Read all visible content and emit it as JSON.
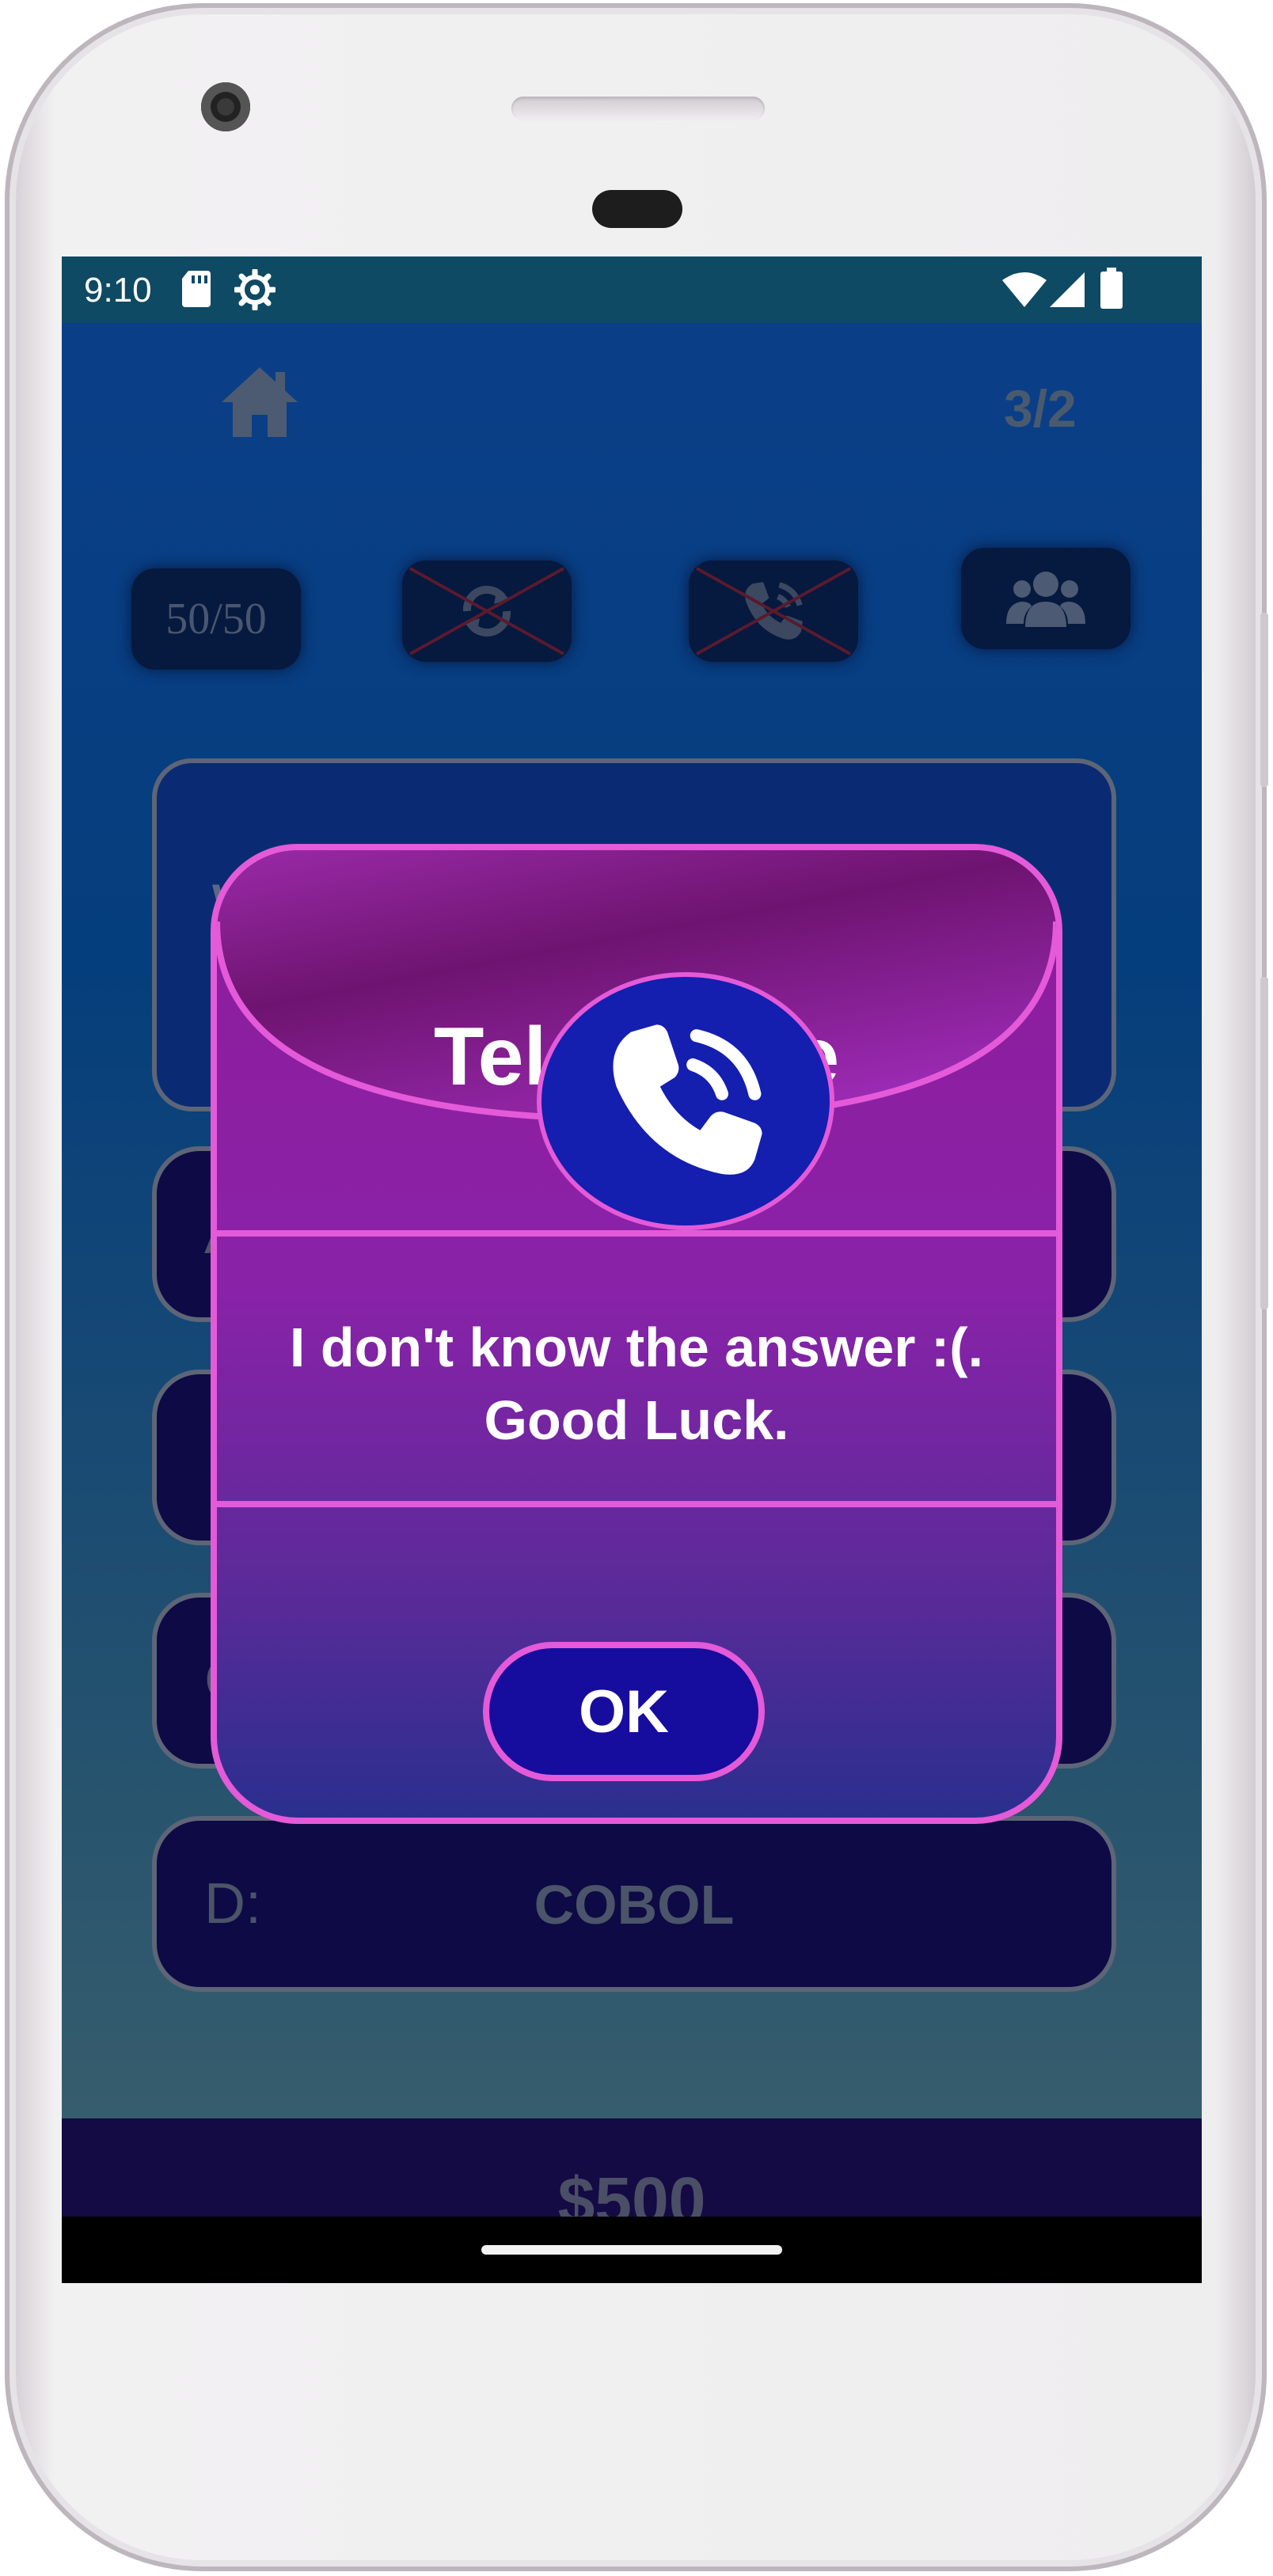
{
  "status_bar": {
    "time": "9:10",
    "icons": [
      "sd-card-icon",
      "settings-gear-icon",
      "wifi-icon",
      "signal-icon",
      "battery-icon"
    ]
  },
  "game": {
    "level": "3/2",
    "lifelines": [
      {
        "label": "50/50",
        "icon": "fifty-fifty",
        "used": false
      },
      {
        "label": "",
        "icon": "swap-question-icon",
        "used": true
      },
      {
        "label": "",
        "icon": "phone-call-icon",
        "used": true
      },
      {
        "label": "",
        "icon": "audience-icon",
        "used": false
      }
    ],
    "question_visible_letter": "W",
    "answers": [
      {
        "letter": "A",
        "text": ""
      },
      {
        "letter": "",
        "text": ""
      },
      {
        "letter": "C",
        "text": ""
      },
      {
        "letter": "D:",
        "text": "COBOL"
      }
    ],
    "prize": "$500"
  },
  "dialog": {
    "title": "Telephone",
    "message_line1": "I don't know the answer :(.",
    "message_line2": "Good Luck.",
    "ok_label": "OK",
    "icon": "phone-call-icon"
  },
  "colors": {
    "dialog_border": "#e45ad8",
    "dialog_fill": "#8a22a8",
    "ok_button": "#160c9e",
    "badge": "#141eaf",
    "status_bar": "#0e4a64"
  }
}
